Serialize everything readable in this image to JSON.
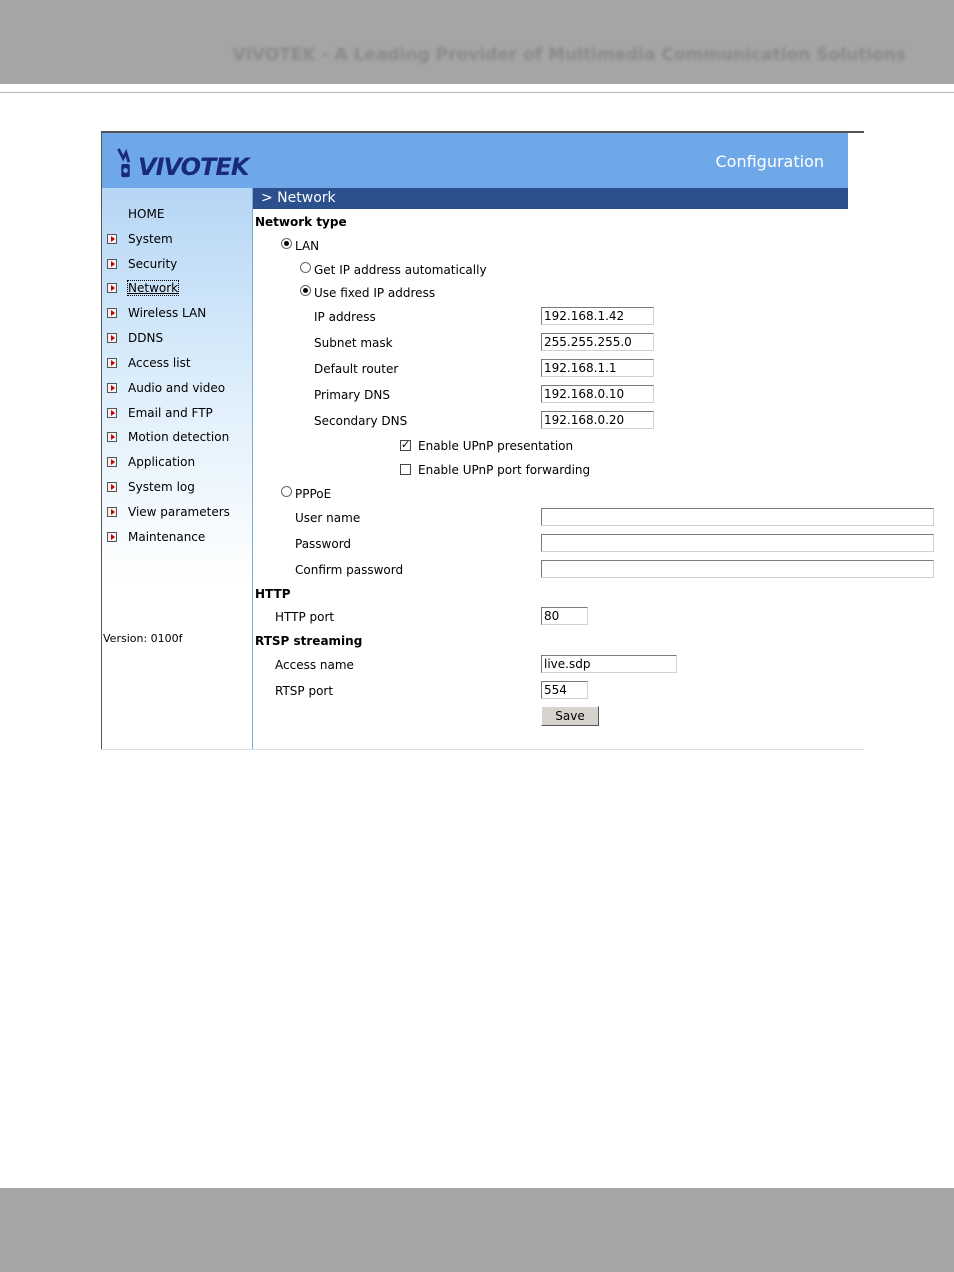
{
  "document": {
    "tagline": "VIVOTEK - A Leading Provider of Multimedia Communication Solutions"
  },
  "header": {
    "logo": "VIVOTEK",
    "title": "Configuration"
  },
  "sidebar": {
    "items": [
      {
        "label": "HOME"
      },
      {
        "label": "System"
      },
      {
        "label": "Security"
      },
      {
        "label": "Network"
      },
      {
        "label": "Wireless LAN"
      },
      {
        "label": "DDNS"
      },
      {
        "label": "Access list"
      },
      {
        "label": "Audio and video"
      },
      {
        "label": "Email and FTP"
      },
      {
        "label": "Motion detection"
      },
      {
        "label": "Application"
      },
      {
        "label": "System log"
      },
      {
        "label": "View parameters"
      },
      {
        "label": "Maintenance"
      }
    ],
    "active": "Network",
    "version": "Version: 0100f"
  },
  "network": {
    "section_title": "> Network",
    "network_type_heading": "Network type",
    "lan_label": "LAN",
    "lan_selected": true,
    "get_ip_auto_label": "Get IP address automatically",
    "use_fixed_ip_label": "Use fixed IP address",
    "fixed_ip_selected": true,
    "ip_address_label": "IP address",
    "ip_address_value": "192.168.1.42",
    "subnet_mask_label": "Subnet mask",
    "subnet_mask_value": "255.255.255.0",
    "default_router_label": "Default router",
    "default_router_value": "192.168.1.1",
    "primary_dns_label": "Primary DNS",
    "primary_dns_value": "192.168.0.10",
    "secondary_dns_label": "Secondary DNS",
    "secondary_dns_value": "192.168.0.20",
    "upnp_presentation_label": "Enable UPnP presentation",
    "upnp_presentation_checked": true,
    "upnp_port_forwarding_label": "Enable UPnP port forwarding",
    "upnp_port_forwarding_checked": false,
    "pppoe_label": "PPPoE",
    "user_name_label": "User name",
    "user_name_value": "",
    "password_label": "Password",
    "password_value": "",
    "confirm_password_label": "Confirm password",
    "confirm_password_value": ""
  },
  "http": {
    "heading": "HTTP",
    "port_label": "HTTP port",
    "port_value": "80"
  },
  "rtsp": {
    "heading": "RTSP streaming",
    "access_name_label": "Access name",
    "access_name_value": "live.sdp",
    "port_label": "RTSP port",
    "port_value": "554"
  },
  "save_label": "Save",
  "colors": {
    "header_bg": "#6fa8e8",
    "section_bar_bg": "#2c4f8e",
    "logo_text": "#1a2a7a"
  }
}
